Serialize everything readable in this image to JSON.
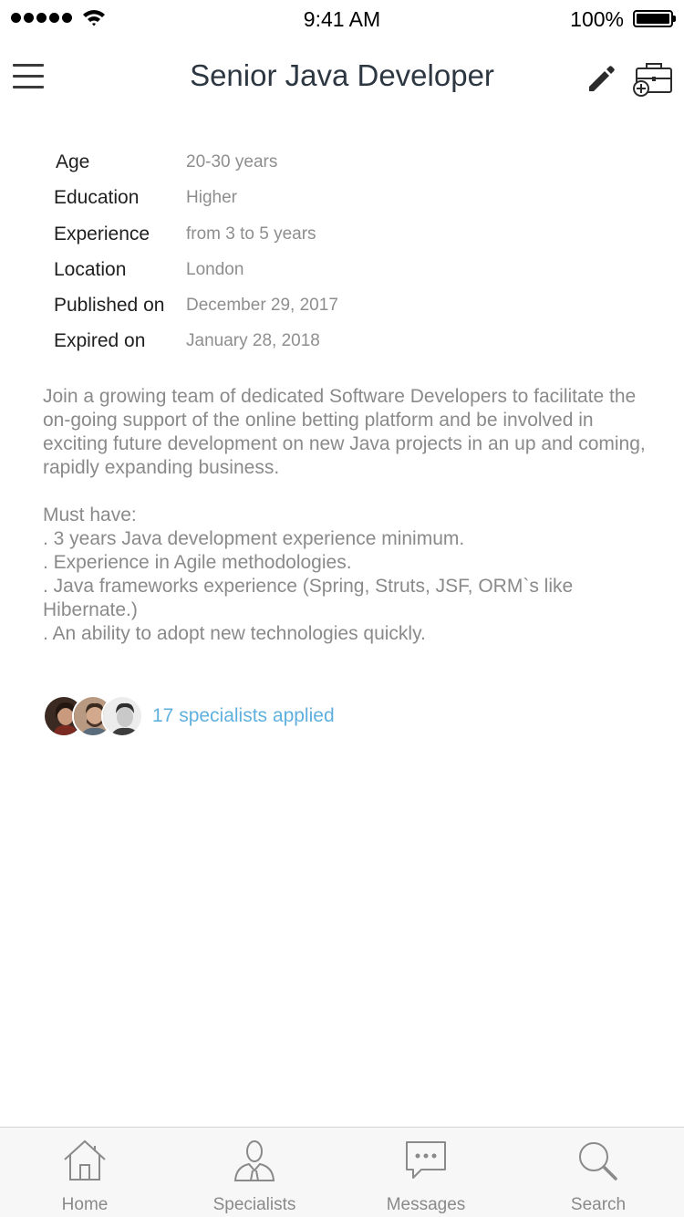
{
  "status_bar": {
    "time": "9:41 AM",
    "battery": "100%"
  },
  "header": {
    "title": "Senior Java Developer",
    "icons": [
      "menu-icon",
      "pencil-icon",
      "briefcase-add-icon"
    ]
  },
  "details": [
    {
      "label": "Age",
      "value": "20-30 years"
    },
    {
      "label": "Education",
      "value": "Higher"
    },
    {
      "label": "Experience",
      "value": "from 3 to 5 years"
    },
    {
      "label": "Location",
      "value": "London"
    },
    {
      "label": "Published on",
      "value": "December 29, 2017"
    },
    {
      "label": "Expired on",
      "value": "January 28, 2018"
    }
  ],
  "description": {
    "intro": "Join a growing team of dedicated Software Developers to facilitate the on-going support of the online betting platform and be involved in exciting future development on new Java projects in an up and coming, rapidly expanding business.",
    "must_have_title": "Must have:",
    "must_have": [
      ". 3 years Java development experience minimum.",
      ". Experience in Agile methodologies.",
      ". Java frameworks experience (Spring, Struts, JSF, ORM`s like Hibernate.)",
      ". An ability to adopt new technologies quickly."
    ]
  },
  "applicants": {
    "text": "17 specialists applied"
  },
  "tab_bar": [
    {
      "label": "Home",
      "icon": "home-icon"
    },
    {
      "label": "Specialists",
      "icon": "person-icon"
    },
    {
      "label": "Messages",
      "icon": "chat-bubble-icon"
    },
    {
      "label": "Search",
      "icon": "search-icon"
    }
  ],
  "colors": {
    "title": "#2d3742",
    "value_text": "#8e8e8e",
    "link": "#5fb0de",
    "tab_bar_bg": "#f7f7f7"
  }
}
